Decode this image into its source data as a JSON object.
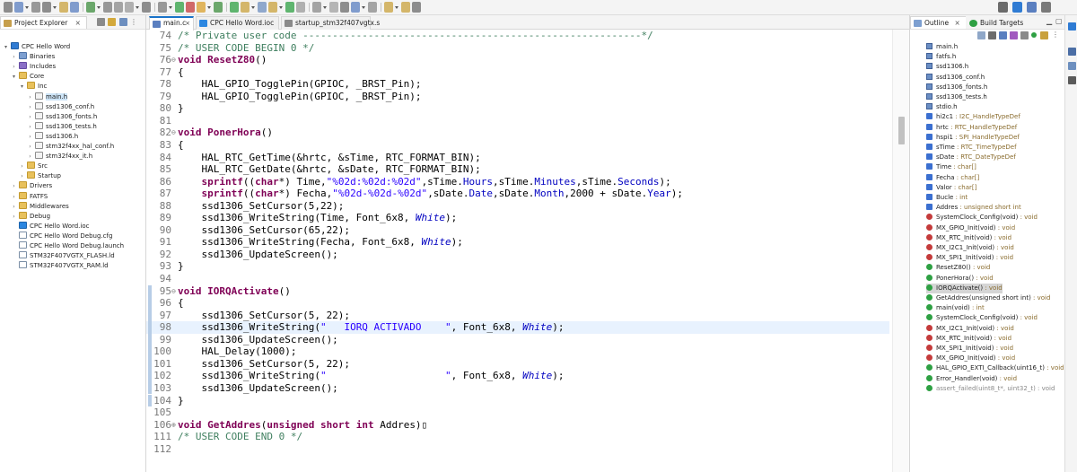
{
  "explorer": {
    "tab_label": "Project Explorer",
    "tree": [
      {
        "label": "CPC Hello Word",
        "depth": 0,
        "arrow": "▾",
        "icon": "project"
      },
      {
        "label": "Binaries",
        "depth": 1,
        "arrow": "›",
        "icon": "binaries"
      },
      {
        "label": "Includes",
        "depth": 1,
        "arrow": "›",
        "icon": "includes"
      },
      {
        "label": "Core",
        "depth": 1,
        "arrow": "▾",
        "icon": "folder"
      },
      {
        "label": "Inc",
        "depth": 2,
        "arrow": "▾",
        "icon": "folder"
      },
      {
        "label": "main.h",
        "depth": 3,
        "arrow": "›",
        "icon": "header",
        "selected": true
      },
      {
        "label": "ssd1306_conf.h",
        "depth": 3,
        "arrow": "›",
        "icon": "header"
      },
      {
        "label": "ssd1306_fonts.h",
        "depth": 3,
        "arrow": "›",
        "icon": "header"
      },
      {
        "label": "ssd1306_tests.h",
        "depth": 3,
        "arrow": "›",
        "icon": "header"
      },
      {
        "label": "ssd1306.h",
        "depth": 3,
        "arrow": "›",
        "icon": "header"
      },
      {
        "label": "stm32f4xx_hal_conf.h",
        "depth": 3,
        "arrow": "›",
        "icon": "header"
      },
      {
        "label": "stm32f4xx_it.h",
        "depth": 3,
        "arrow": "›",
        "icon": "header"
      },
      {
        "label": "Src",
        "depth": 2,
        "arrow": "›",
        "icon": "folder"
      },
      {
        "label": "Startup",
        "depth": 2,
        "arrow": "›",
        "icon": "folder"
      },
      {
        "label": "Drivers",
        "depth": 1,
        "arrow": "›",
        "icon": "folder"
      },
      {
        "label": "FATFS",
        "depth": 1,
        "arrow": "›",
        "icon": "folder"
      },
      {
        "label": "Middlewares",
        "depth": 1,
        "arrow": "›",
        "icon": "folder"
      },
      {
        "label": "Debug",
        "depth": 1,
        "arrow": "›",
        "icon": "folder"
      },
      {
        "label": "CPC Hello Word.ioc",
        "depth": 1,
        "arrow": "",
        "icon": "ioc"
      },
      {
        "label": "CPC Hello Word Debug.cfg",
        "depth": 1,
        "arrow": "",
        "icon": "file"
      },
      {
        "label": "CPC Hello Word Debug.launch",
        "depth": 1,
        "arrow": "",
        "icon": "file"
      },
      {
        "label": "STM32F407VGTX_FLASH.ld",
        "depth": 1,
        "arrow": "",
        "icon": "file"
      },
      {
        "label": "STM32F407VGTX_RAM.ld",
        "depth": 1,
        "arrow": "",
        "icon": "file"
      }
    ]
  },
  "editor": {
    "tabs": [
      {
        "label": "main.c",
        "active": true,
        "closable": true
      },
      {
        "label": "CPC Hello Word.ioc",
        "active": false,
        "closable": false
      },
      {
        "label": "startup_stm32f407vgtx.s",
        "active": false,
        "closable": false
      }
    ],
    "lines": [
      {
        "n": "74",
        "fold": "",
        "segs": [
          {
            "t": "/* Private user code ---------------------------------------------------------*/",
            "c": "cm"
          }
        ]
      },
      {
        "n": "75",
        "fold": "",
        "segs": [
          {
            "t": "/* USER CODE BEGIN 0 */",
            "c": "cm"
          }
        ]
      },
      {
        "n": "76",
        "fold": "⊖",
        "segs": [
          {
            "t": "void ",
            "c": "kw"
          },
          {
            "t": "ResetZ80",
            "c": "kw"
          },
          {
            "t": "()",
            "c": ""
          }
        ]
      },
      {
        "n": "77",
        "fold": "",
        "segs": [
          {
            "t": "{",
            "c": ""
          }
        ]
      },
      {
        "n": "78",
        "fold": "",
        "segs": [
          {
            "t": "    HAL_GPIO_TogglePin(GPIOC, _BRST_Pin);",
            "c": ""
          }
        ]
      },
      {
        "n": "79",
        "fold": "",
        "segs": [
          {
            "t": "    HAL_GPIO_TogglePin(GPIOC, _BRST_Pin);",
            "c": ""
          }
        ]
      },
      {
        "n": "80",
        "fold": "",
        "segs": [
          {
            "t": "}",
            "c": ""
          }
        ]
      },
      {
        "n": "81",
        "fold": "",
        "segs": []
      },
      {
        "n": "82",
        "fold": "⊖",
        "segs": [
          {
            "t": "void ",
            "c": "kw"
          },
          {
            "t": "PonerHora",
            "c": "kw"
          },
          {
            "t": "()",
            "c": ""
          }
        ]
      },
      {
        "n": "83",
        "fold": "",
        "segs": [
          {
            "t": "{",
            "c": ""
          }
        ]
      },
      {
        "n": "84",
        "fold": "",
        "segs": [
          {
            "t": "    HAL_RTC_GetTime(&hrtc, &sTime, RTC_FORMAT_BIN);",
            "c": ""
          }
        ]
      },
      {
        "n": "85",
        "fold": "",
        "segs": [
          {
            "t": "    HAL_RTC_GetDate(&hrtc, &sDate, RTC_FORMAT_BIN);",
            "c": ""
          }
        ]
      },
      {
        "n": "86",
        "fold": "",
        "segs": [
          {
            "t": "    ",
            "c": ""
          },
          {
            "t": "sprintf",
            "c": "kw"
          },
          {
            "t": "((",
            "c": ""
          },
          {
            "t": "char",
            "c": "kw"
          },
          {
            "t": "*) Time,",
            "c": ""
          },
          {
            "t": "\"%02d:%02d:%02d\"",
            "c": "st"
          },
          {
            "t": ",sTime.",
            "c": ""
          },
          {
            "t": "Hours",
            "c": "fld"
          },
          {
            "t": ",sTime.",
            "c": ""
          },
          {
            "t": "Minutes",
            "c": "fld"
          },
          {
            "t": ",sTime.",
            "c": ""
          },
          {
            "t": "Seconds",
            "c": "fld"
          },
          {
            "t": ");",
            "c": ""
          }
        ]
      },
      {
        "n": "87",
        "fold": "",
        "segs": [
          {
            "t": "    ",
            "c": ""
          },
          {
            "t": "sprintf",
            "c": "kw"
          },
          {
            "t": "((",
            "c": ""
          },
          {
            "t": "char",
            "c": "kw"
          },
          {
            "t": "*) Fecha,",
            "c": ""
          },
          {
            "t": "\"%02d-%02d-%02d\"",
            "c": "st"
          },
          {
            "t": ",sDate.",
            "c": ""
          },
          {
            "t": "Date",
            "c": "fld"
          },
          {
            "t": ",sDate.",
            "c": ""
          },
          {
            "t": "Month",
            "c": "fld"
          },
          {
            "t": ",2000 + sDate.",
            "c": ""
          },
          {
            "t": "Year",
            "c": "fld"
          },
          {
            "t": ");",
            "c": ""
          }
        ]
      },
      {
        "n": "88",
        "fold": "",
        "segs": [
          {
            "t": "    ssd1306_SetCursor(5,22);",
            "c": ""
          }
        ]
      },
      {
        "n": "89",
        "fold": "",
        "segs": [
          {
            "t": "    ssd1306_WriteString(Time, Font_6x8, ",
            "c": ""
          },
          {
            "t": "White",
            "c": "it"
          },
          {
            "t": ");",
            "c": ""
          }
        ]
      },
      {
        "n": "90",
        "fold": "",
        "segs": [
          {
            "t": "    ssd1306_SetCursor(65,22);",
            "c": ""
          }
        ]
      },
      {
        "n": "91",
        "fold": "",
        "segs": [
          {
            "t": "    ssd1306_WriteString(Fecha, Font_6x8, ",
            "c": ""
          },
          {
            "t": "White",
            "c": "it"
          },
          {
            "t": ");",
            "c": ""
          }
        ]
      },
      {
        "n": "92",
        "fold": "",
        "segs": [
          {
            "t": "    ssd1306_UpdateScreen();",
            "c": ""
          }
        ]
      },
      {
        "n": "93",
        "fold": "",
        "segs": [
          {
            "t": "}",
            "c": ""
          }
        ]
      },
      {
        "n": "94",
        "fold": "",
        "segs": []
      },
      {
        "n": "95",
        "fold": "⊖",
        "mark": true,
        "segs": [
          {
            "t": "void ",
            "c": "kw"
          },
          {
            "t": "IORQActivate",
            "c": "kw"
          },
          {
            "t": "()",
            "c": ""
          }
        ]
      },
      {
        "n": "96",
        "fold": "",
        "mark": true,
        "segs": [
          {
            "t": "{",
            "c": ""
          }
        ]
      },
      {
        "n": "97",
        "fold": "",
        "mark": true,
        "segs": [
          {
            "t": "    ssd1306_SetCursor(5, 22);",
            "c": ""
          }
        ]
      },
      {
        "n": "98",
        "fold": "",
        "mark": true,
        "current": true,
        "segs": [
          {
            "t": "    ssd1306_WriteString(",
            "c": ""
          },
          {
            "t": "\"   IORQ ACTIVADO    \"",
            "c": "st"
          },
          {
            "t": ", Font_6x8, ",
            "c": ""
          },
          {
            "t": "White",
            "c": "it"
          },
          {
            "t": ");",
            "c": ""
          }
        ]
      },
      {
        "n": "99",
        "fold": "",
        "mark": true,
        "segs": [
          {
            "t": "    ssd1306_UpdateScreen();",
            "c": ""
          }
        ]
      },
      {
        "n": "100",
        "fold": "",
        "mark": true,
        "segs": [
          {
            "t": "    HAL_Delay(1000);",
            "c": ""
          }
        ]
      },
      {
        "n": "101",
        "fold": "",
        "mark": true,
        "segs": [
          {
            "t": "    ssd1306_SetCursor(5, 22);",
            "c": ""
          }
        ]
      },
      {
        "n": "102",
        "fold": "",
        "mark": true,
        "segs": [
          {
            "t": "    ssd1306_WriteString(",
            "c": ""
          },
          {
            "t": "\"                    \"",
            "c": "st"
          },
          {
            "t": ", Font_6x8, ",
            "c": ""
          },
          {
            "t": "White",
            "c": "it"
          },
          {
            "t": ");",
            "c": ""
          }
        ]
      },
      {
        "n": "103",
        "fold": "",
        "mark": true,
        "segs": [
          {
            "t": "    ssd1306_UpdateScreen();",
            "c": ""
          }
        ]
      },
      {
        "n": "104",
        "fold": "",
        "mark": true,
        "segs": [
          {
            "t": "}",
            "c": ""
          }
        ]
      },
      {
        "n": "105",
        "fold": "",
        "segs": []
      },
      {
        "n": "106",
        "fold": "⊕",
        "segs": [
          {
            "t": "void ",
            "c": "kw"
          },
          {
            "t": "GetAddres",
            "c": "kw"
          },
          {
            "t": "(",
            "c": ""
          },
          {
            "t": "unsigned short int",
            "c": "kw"
          },
          {
            "t": " Addres)▯",
            "c": ""
          }
        ]
      },
      {
        "n": "111",
        "fold": "",
        "segs": [
          {
            "t": "/* USER CODE END 0 */",
            "c": "cm"
          }
        ]
      },
      {
        "n": "112",
        "fold": "",
        "segs": []
      }
    ]
  },
  "outline": {
    "tabs": [
      {
        "label": "Outline"
      },
      {
        "label": "Build Targets"
      }
    ],
    "items": [
      {
        "name": "main.h",
        "type": "",
        "kind": "include"
      },
      {
        "name": "fatfs.h",
        "type": "",
        "kind": "include"
      },
      {
        "name": "ssd1306.h",
        "type": "",
        "kind": "include"
      },
      {
        "name": "ssd1306_conf.h",
        "type": "",
        "kind": "include"
      },
      {
        "name": "ssd1306_fonts.h",
        "type": "",
        "kind": "include"
      },
      {
        "name": "ssd1306_tests.h",
        "type": "",
        "kind": "include"
      },
      {
        "name": "stdio.h",
        "type": "",
        "kind": "include"
      },
      {
        "name": "hi2c1",
        "type": " : I2C_HandleTypeDef",
        "kind": "var"
      },
      {
        "name": "hrtc",
        "type": " : RTC_HandleTypeDef",
        "kind": "var"
      },
      {
        "name": "hspi1",
        "type": " : SPI_HandleTypeDef",
        "kind": "var"
      },
      {
        "name": "sTime",
        "type": " : RTC_TimeTypeDef",
        "kind": "var"
      },
      {
        "name": "sDate",
        "type": " : RTC_DateTypeDef",
        "kind": "var"
      },
      {
        "name": "Time",
        "type": " : char[]",
        "kind": "var"
      },
      {
        "name": "Fecha",
        "type": " : char[]",
        "kind": "var"
      },
      {
        "name": "Valor",
        "type": " : char[]",
        "kind": "var"
      },
      {
        "name": "Bucle",
        "type": " : int",
        "kind": "var"
      },
      {
        "name": "Addres",
        "type": " : unsigned short int",
        "kind": "var"
      },
      {
        "name": "SystemClock_Config(void)",
        "type": " : void",
        "kind": "fnp"
      },
      {
        "name": "MX_GPIO_Init(void)",
        "type": " : void",
        "kind": "fnp"
      },
      {
        "name": "MX_RTC_Init(void)",
        "type": " : void",
        "kind": "fnp"
      },
      {
        "name": "MX_I2C1_Init(void)",
        "type": " : void",
        "kind": "fnp"
      },
      {
        "name": "MX_SPI1_Init(void)",
        "type": " : void",
        "kind": "fnp"
      },
      {
        "name": "ResetZ80()",
        "type": " : void",
        "kind": "fn"
      },
      {
        "name": "PonerHora()",
        "type": " : void",
        "kind": "fn"
      },
      {
        "name": "IORQActivate()",
        "type": " : void",
        "kind": "fn",
        "selected": true
      },
      {
        "name": "GetAddres(unsigned short int)",
        "type": " : void",
        "kind": "fn"
      },
      {
        "name": "main(void)",
        "type": " : int",
        "kind": "fn"
      },
      {
        "name": "SystemClock_Config(void)",
        "type": " : void",
        "kind": "fn"
      },
      {
        "name": "MX_I2C1_Init(void)",
        "type": " : void",
        "kind": "fnp"
      },
      {
        "name": "MX_RTC_Init(void)",
        "type": " : void",
        "kind": "fnp"
      },
      {
        "name": "MX_SPI1_Init(void)",
        "type": " : void",
        "kind": "fnp"
      },
      {
        "name": "MX_GPIO_Init(void)",
        "type": " : void",
        "kind": "fnp"
      },
      {
        "name": "HAL_GPIO_EXTI_Callback(uint16_t)",
        "type": " : void",
        "kind": "fn"
      },
      {
        "name": "Error_Handler(void)",
        "type": " : void",
        "kind": "fn"
      },
      {
        "name": "assert_failed(uint8_t*, uint32_t)",
        "type": " : void",
        "kind": "fn",
        "muted": true
      }
    ]
  },
  "colors": {
    "keyword": "#7f0055",
    "comment": "#3f7f5f",
    "string": "#2a00ff",
    "field": "#0000c0",
    "current_line": "#e8f2fe",
    "accent": "#1a73c9"
  }
}
